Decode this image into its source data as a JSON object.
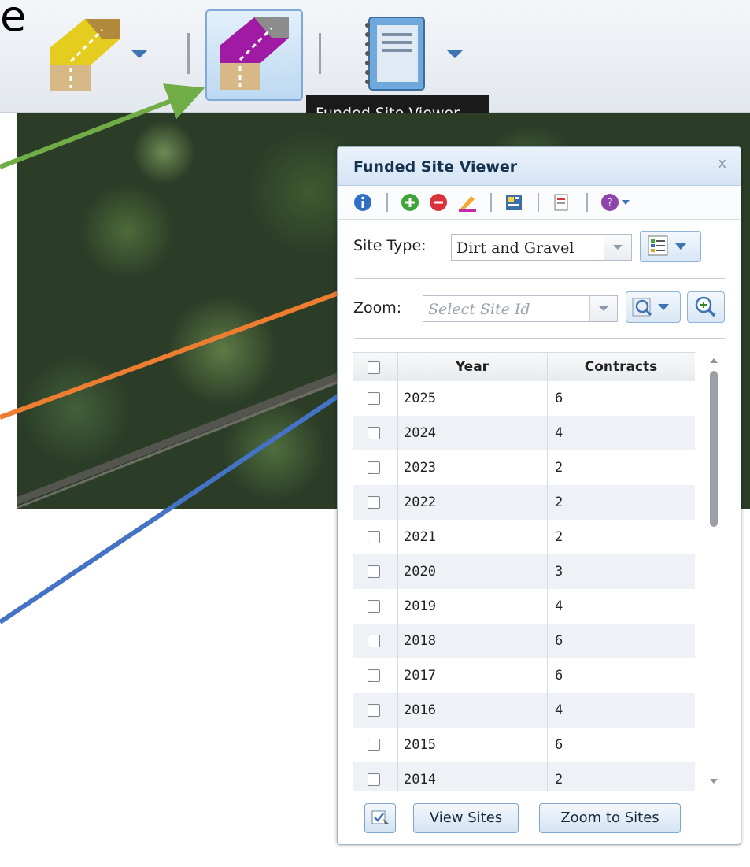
{
  "header_cut_text": "e",
  "toolbar": {
    "tools": [
      {
        "name": "dirt-gravel-tool",
        "color": "#e4cd1e"
      },
      {
        "name": "funded-site-viewer-tool",
        "color": "#a11aa3"
      },
      {
        "name": "notebook-tool"
      }
    ],
    "tooltip": "Funded Site Viewer"
  },
  "annotation_colors": {
    "green": "#70ad47",
    "orange": "#ed7d31",
    "blue": "#4472c4"
  },
  "panel": {
    "title": "Funded Site Viewer",
    "close": "x",
    "tool_icons": [
      "info-icon",
      "add-icon",
      "remove-icon",
      "edit-icon",
      "report-icon",
      "export-icon",
      "help-icon"
    ],
    "site_type_label": "Site Type:",
    "site_type_value": "Dirt and Gravel",
    "zoom_label": "Zoom:",
    "zoom_placeholder": "Select Site Id",
    "table": {
      "columns": [
        "Year",
        "Contracts"
      ],
      "rows": [
        {
          "year": "2025",
          "contracts": "6"
        },
        {
          "year": "2024",
          "contracts": "4"
        },
        {
          "year": "2023",
          "contracts": "2"
        },
        {
          "year": "2022",
          "contracts": "2"
        },
        {
          "year": "2021",
          "contracts": "2"
        },
        {
          "year": "2020",
          "contracts": "3"
        },
        {
          "year": "2019",
          "contracts": "4"
        },
        {
          "year": "2018",
          "contracts": "6"
        },
        {
          "year": "2017",
          "contracts": "6"
        },
        {
          "year": "2016",
          "contracts": "4"
        },
        {
          "year": "2015",
          "contracts": "6"
        },
        {
          "year": "2014",
          "contracts": "2"
        }
      ]
    },
    "buttons": {
      "view_sites": "View Sites",
      "zoom_to_sites": "Zoom to Sites"
    }
  }
}
